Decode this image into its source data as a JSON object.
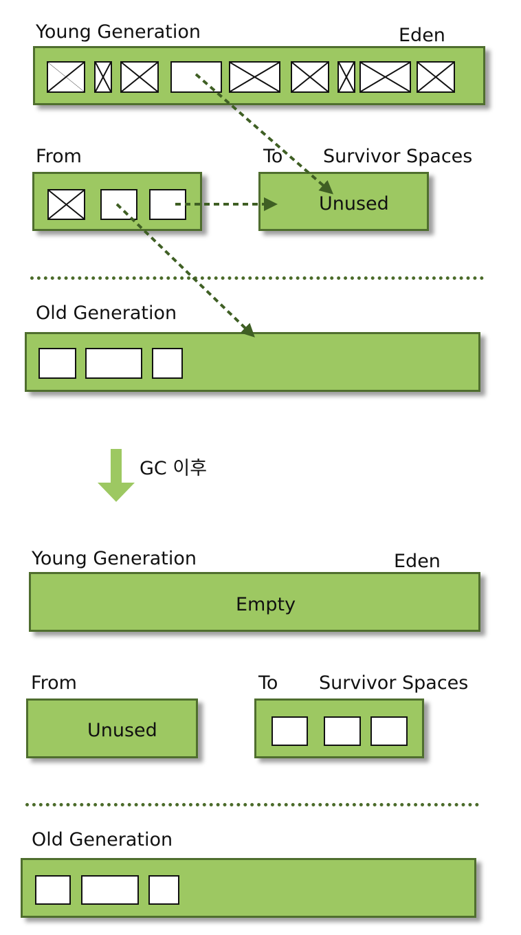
{
  "before": {
    "young_label": "Young Generation",
    "eden_label": "Eden",
    "from_label": "From",
    "to_label": "To",
    "survivor_label": "Survivor Spaces",
    "to_space_text": "Unused",
    "old_label": "Old Generation"
  },
  "transition_label": "GC 이후",
  "after": {
    "young_label": "Young Generation",
    "eden_label": "Eden",
    "eden_text": "Empty",
    "from_label": "From",
    "from_space_text": "Unused",
    "to_label": "To",
    "survivor_label": "Survivor Spaces",
    "old_label": "Old Generation"
  },
  "colors": {
    "region_fill": "#9dc862",
    "region_border": "#4f6e2e",
    "arrow": "#3f5f24",
    "down_arrow": "#9dc862"
  }
}
